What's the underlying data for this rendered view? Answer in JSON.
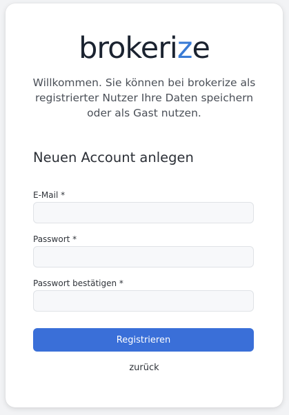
{
  "brand": {
    "logo_main": "brokeri",
    "logo_accent": "z",
    "logo_end": "e",
    "accent_color": "#3a7bd5"
  },
  "intro": {
    "welcome_text": "Willkommen. Sie können bei brokerize als registrierter Nutzer Ihre Daten speichern oder als Gast nutzen."
  },
  "form": {
    "title": "Neuen Account anlegen",
    "email_label": "E-Mail *",
    "email_value": "",
    "password_label": "Passwort *",
    "password_value": "",
    "password_confirm_label": "Passwort bestätigen *",
    "password_confirm_value": "",
    "submit_label": "Registrieren",
    "back_label": "zurück",
    "primary_color": "#3a6fd8"
  }
}
